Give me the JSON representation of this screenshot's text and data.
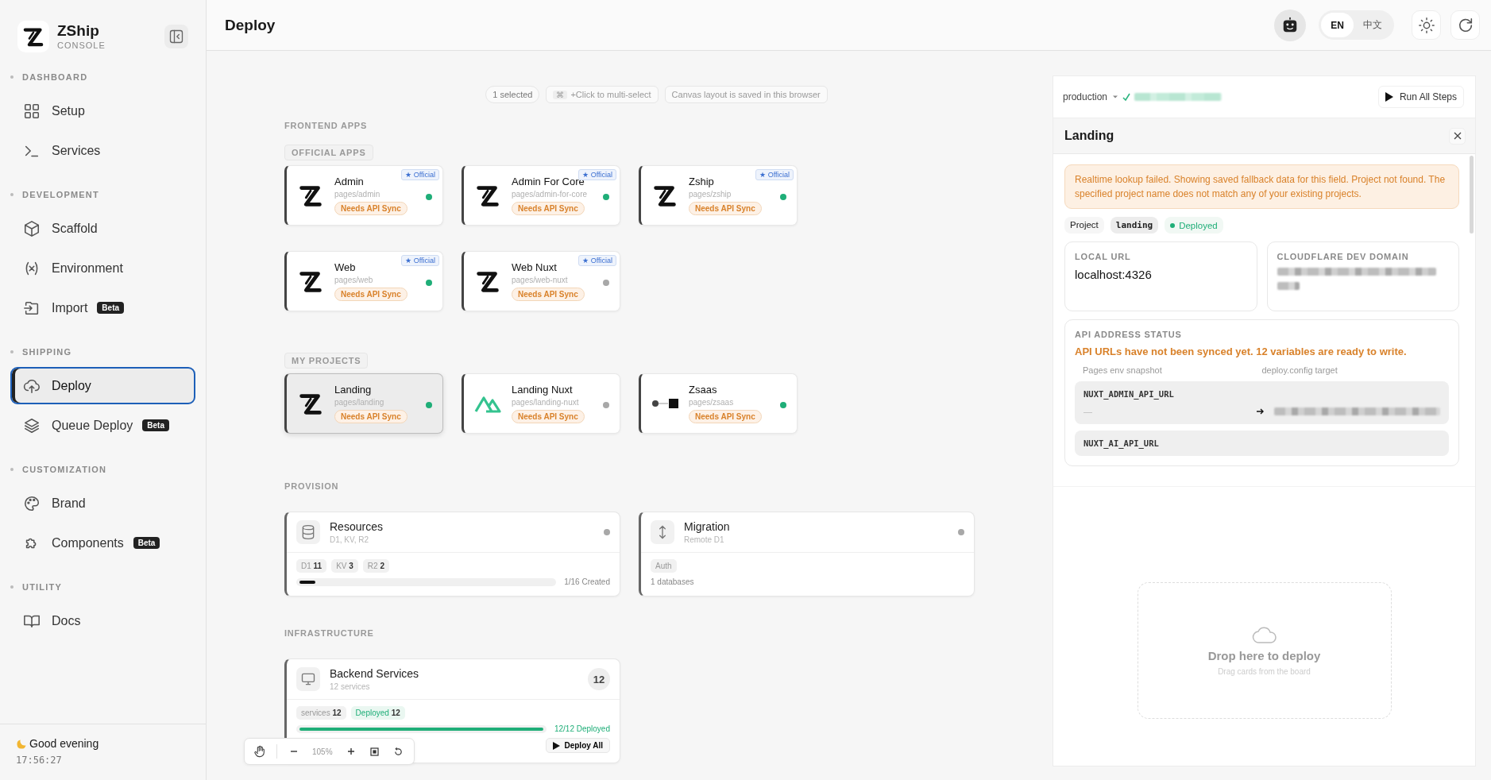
{
  "sidebar": {
    "brand": {
      "name": "ZShip",
      "subtitle": "CONSOLE"
    },
    "sections": [
      {
        "title": "DASHBOARD",
        "items": [
          {
            "label": "Setup",
            "selected": false
          },
          {
            "label": "Services",
            "selected": false
          }
        ]
      },
      {
        "title": "DEVELOPMENT",
        "items": [
          {
            "label": "Scaffold",
            "selected": false
          },
          {
            "label": "Environment",
            "selected": false
          },
          {
            "label": "Import",
            "selected": false,
            "badge": "Beta"
          }
        ]
      },
      {
        "title": "SHIPPING",
        "items": [
          {
            "label": "Deploy",
            "selected": true
          },
          {
            "label": "Queue Deploy",
            "selected": false,
            "badge": "Beta"
          }
        ]
      },
      {
        "title": "CUSTOMIZATION",
        "items": [
          {
            "label": "Brand",
            "selected": false
          },
          {
            "label": "Components",
            "selected": false,
            "badge": "Beta"
          }
        ]
      },
      {
        "title": "UTILITY",
        "items": [
          {
            "label": "Docs",
            "selected": false
          }
        ]
      }
    ],
    "footer": {
      "greeting": "Good evening",
      "time": "17:56:27"
    }
  },
  "header": {
    "title": "Deploy",
    "languages": [
      {
        "label": "EN",
        "selected": true
      },
      {
        "label": "中文",
        "selected": false
      }
    ]
  },
  "canvas": {
    "hints": [
      {
        "text": "1 selected"
      },
      {
        "key": "⌘",
        "text": "+Click to multi-select"
      },
      {
        "text": "Canvas layout is saved in this browser"
      }
    ],
    "frontend": {
      "title": "FRONTEND APPS",
      "groups": [
        {
          "title": "OFFICIAL APPS",
          "rows": [
            [
              {
                "name": "Admin",
                "path": "pages/admin",
                "badge": "Needs API Sync",
                "tag": "★ Official",
                "color": "#1fae78",
                "selected": false
              },
              {
                "name": "Admin For Core",
                "path": "pages/admin-for-core",
                "badge": "Needs API Sync",
                "tag": "★ Official",
                "color": "#1fae78",
                "selected": false
              },
              {
                "name": "Zship",
                "path": "pages/zship",
                "badge": "Needs API Sync",
                "tag": "★ Official",
                "color": "#1fae78",
                "selected": false
              }
            ],
            [
              {
                "name": "Web",
                "path": "pages/web",
                "badge": "Needs API Sync",
                "tag": "★ Official",
                "color": "#1fae78",
                "selected": false
              },
              {
                "name": "Web Nuxt",
                "path": "pages/web-nuxt",
                "badge": "Needs API Sync",
                "tag": "★ Official",
                "color": "#a8a8a8",
                "selected": false
              }
            ]
          ]
        },
        {
          "title": "MY PROJECTS",
          "rows": [
            [
              {
                "name": "Landing",
                "path": "pages/landing",
                "badge": "Needs API Sync",
                "color": "#1fae78",
                "selected": true
              },
              {
                "name": "Landing Nuxt",
                "path": "pages/landing-nuxt",
                "badge": "Needs API Sync",
                "color": "#a8a8a8",
                "selected": false
              },
              {
                "name": "Zsaas",
                "path": "pages/zsaas",
                "badge": "Needs API Sync",
                "color": "#1fae78",
                "selected": false
              }
            ]
          ]
        }
      ]
    },
    "provision": {
      "title": "PROVISION",
      "cards": [
        {
          "name": "Resources",
          "subtitle": "D1, KV, R2",
          "color": "#a8a8a8",
          "chips": [
            {
              "label": "D1",
              "value": "11",
              "kind": "plain"
            },
            {
              "label": "KV",
              "value": "3",
              "kind": "plain"
            },
            {
              "label": "R2",
              "value": "2",
              "kind": "plain"
            }
          ],
          "progress": {
            "level": 0.0625,
            "text": "1/16 Created",
            "color": "#111111"
          }
        },
        {
          "name": "Migration",
          "subtitle": "Remote D1",
          "color": "#a8a8a8",
          "chips": [
            {
              "label": "Auth",
              "kind": "plain"
            }
          ],
          "note": "1 databases"
        }
      ]
    },
    "infrastructure": {
      "title": "INFRASTRUCTURE",
      "cards": [
        {
          "name": "Backend Services",
          "subtitle": "12 services",
          "count": "12",
          "chips": [
            {
              "label": "services",
              "value": "12",
              "kind": "plain"
            },
            {
              "label": "Deployed",
              "value": "12",
              "kind": "success"
            }
          ],
          "progress": {
            "level": 1,
            "text": "12/12 Deployed",
            "color": "#1fae78"
          },
          "action": "Deploy All"
        }
      ]
    },
    "zoom": "105%"
  },
  "panel": {
    "environment": "production",
    "run_button": "Run All Steps",
    "detail": {
      "title": "Landing",
      "warning": "Realtime lookup failed. Showing saved fallback data for this field. Project not found. The specified project name does not match any of your existing projects.",
      "project_label": "Project",
      "project_name": "landing",
      "status": "Deployed",
      "local_url": {
        "label": "LOCAL URL",
        "value": "localhost:4326"
      },
      "dev_domain": {
        "label": "CLOUDFLARE DEV DOMAIN"
      },
      "api": {
        "title": "API ADDRESS STATUS",
        "message": "API URLs have not been synced yet. 12 variables are ready to write.",
        "columns": [
          "Pages env snapshot",
          "deploy.config target"
        ],
        "rows": [
          {
            "name": "NUXT_ADMIN_API_URL",
            "snapshot": "—"
          },
          {
            "name": "NUXT_AI_API_URL"
          }
        ]
      }
    },
    "dropzone": {
      "title": "Drop here to deploy",
      "subtitle": "Drag cards from the board"
    }
  }
}
